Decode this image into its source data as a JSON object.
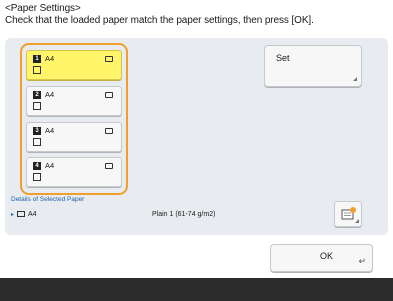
{
  "header": {
    "title": "<Paper Settings>",
    "instruction": "Check that the loaded paper match the paper settings, then press [OK]."
  },
  "trays": [
    {
      "number": "1",
      "size": "A4",
      "selected": true
    },
    {
      "number": "2",
      "size": "A4",
      "selected": false
    },
    {
      "number": "3",
      "size": "A4",
      "selected": false
    },
    {
      "number": "4",
      "size": "A4",
      "selected": false
    }
  ],
  "set_button": {
    "label": "Set"
  },
  "details": {
    "label": "Details of Selected Paper",
    "size": "A4",
    "type": "Plain 1 (61-74 g/m2)"
  },
  "ok_button": {
    "label": "OK"
  },
  "icons": {
    "tray_paper": "paper-orientation-icon",
    "tray_type": "paper-type-icon",
    "settings": "paper-settings-icon",
    "enter": "enter-icon"
  },
  "colors": {
    "selected_tray": "#fff46a",
    "group_border": "#f0a02a",
    "panel": "#e8ebef",
    "accent_text": "#1e64a8"
  }
}
